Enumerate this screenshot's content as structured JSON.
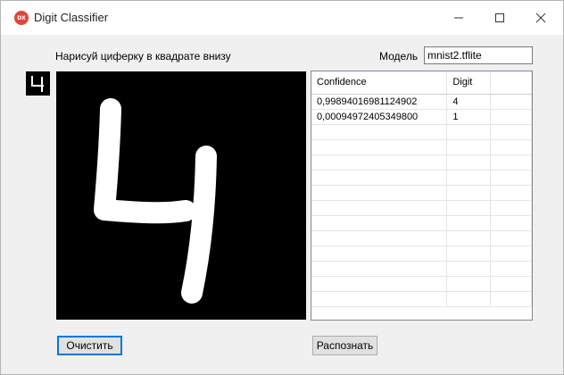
{
  "window": {
    "title": "Digit Classifier",
    "icon_text": "DX",
    "icon": "dx-app-icon",
    "controls": [
      "minimize-icon",
      "maximize-icon",
      "close-icon"
    ]
  },
  "prompt_label": "Нарисуй циферку в квадрате внизу",
  "model": {
    "label": "Модель",
    "value": "mnist2.tflite"
  },
  "drawing": {
    "preview_digit": "4",
    "canvas_digit": "4"
  },
  "results": {
    "columns": [
      "Confidence",
      "Digit",
      ""
    ],
    "rows": [
      [
        "0,99894016981124902",
        "4"
      ],
      [
        "0,00094972405349800",
        "1"
      ]
    ]
  },
  "buttons": {
    "clear": "Очистить",
    "recognize": "Распознать"
  },
  "colors": {
    "accent": "#0078d7",
    "icon": "#e0463b",
    "canvas": "#000000",
    "stroke": "#ffffff"
  }
}
